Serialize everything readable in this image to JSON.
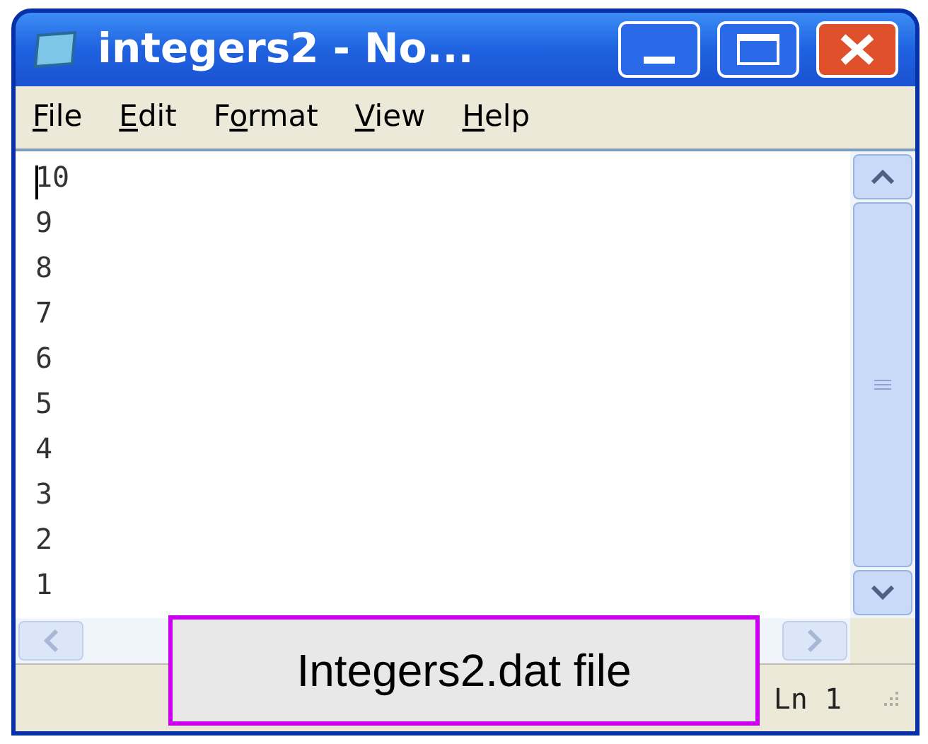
{
  "window": {
    "title": "integers2 - No..."
  },
  "menu": [
    {
      "key": "F",
      "after": "ile"
    },
    {
      "key": "E",
      "after": "dit"
    },
    {
      "before": "F",
      "key": "o",
      "after": "rmat"
    },
    {
      "key": "V",
      "after": "iew"
    },
    {
      "key": "H",
      "after": "elp"
    }
  ],
  "editor": {
    "lines": [
      "10",
      "9",
      "8",
      "7",
      "6",
      "5",
      "4",
      "3",
      "2",
      "1"
    ]
  },
  "status_bar": {
    "position": "Ln 1"
  },
  "caption": "Integers2.dat file"
}
